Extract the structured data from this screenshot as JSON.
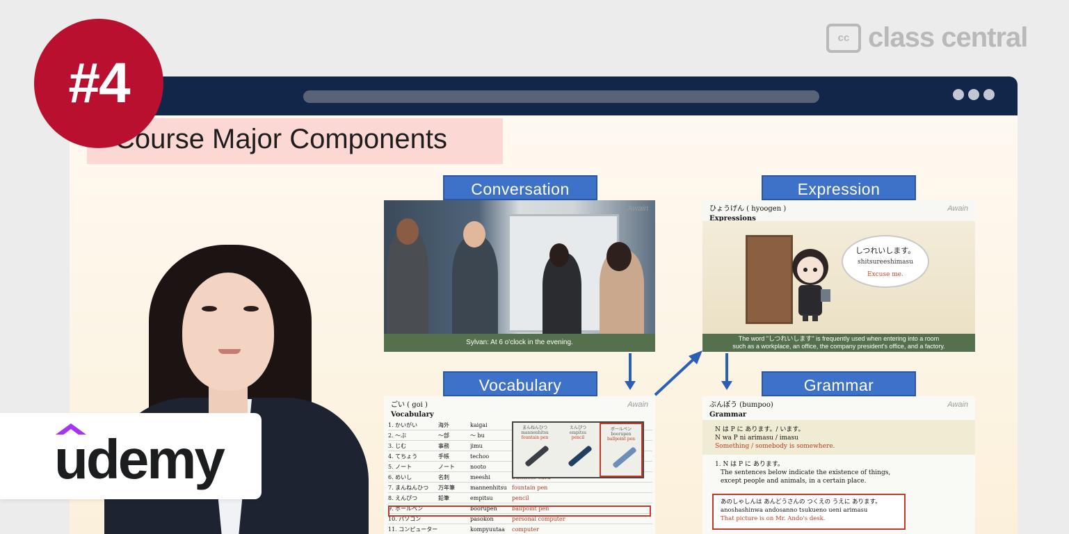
{
  "badge": {
    "rank": "#4",
    "color": "#b8102e"
  },
  "watermark": {
    "icon": "cc",
    "text": "class central"
  },
  "browser": {
    "bar_color": "#12264a",
    "dots_icon": "ellipsis-icon"
  },
  "slide": {
    "title": "Course Major Components",
    "sections": {
      "conversation": "Conversation",
      "expression": "Expression",
      "vocabulary": "Vocabulary",
      "grammar": "Grammar"
    },
    "brand_mark": "Awain",
    "conversation_panel": {
      "subtitle": "Sylvan: At 6 o'clock in the evening."
    },
    "expression_panel": {
      "title_jp": "ひょうげん ( hyoogen )",
      "title_en": "Expressions",
      "bubble_jp": "しつれいします。",
      "bubble_romaji": "shitsureeshimasu",
      "bubble_en": "Excuse me.",
      "caption_line1": "The word \"しつれいします\" is frequently used when entering into a room",
      "caption_line2": "such as a workplace, an office, the company president's office, and a factory."
    },
    "vocabulary_panel": {
      "title_jp": "ごい ( goi )",
      "title_en": "Vocabulary",
      "rows": [
        {
          "kana": "1. かいがい",
          "kanji": "海外",
          "romaji": "kaigai",
          "en": ""
        },
        {
          "kana": "2. ～ぶ",
          "kanji": "～部",
          "romaji": "～ bu",
          "en": ""
        },
        {
          "kana": "3. じむ",
          "kanji": "事務",
          "romaji": "jimu",
          "en": ""
        },
        {
          "kana": "4. てちょう",
          "kanji": "手帳",
          "romaji": "techoo",
          "en": ""
        },
        {
          "kana": "5. ノート",
          "kanji": "ノート",
          "romaji": "nooto",
          "en": ""
        },
        {
          "kana": "6. めいし",
          "kanji": "名刺",
          "romaji": "meeshi",
          "en": "business card"
        },
        {
          "kana": "7. まんねんひつ",
          "kanji": "万年筆",
          "romaji": "mannenhitsu",
          "en": "fountain pen"
        },
        {
          "kana": "8. えんぴつ",
          "kanji": "鉛筆",
          "romaji": "empitsu",
          "en": "pencil"
        },
        {
          "kana": "9. ボールペン",
          "kanji": "",
          "romaji": "boorupen",
          "en": "ballpoint pen"
        },
        {
          "kana": "10. パソコン",
          "kanji": "",
          "romaji": "pasokon",
          "en": "personal computer"
        },
        {
          "kana": "11. コンピューター",
          "kanji": "",
          "romaji": "kompyuutaa",
          "en": "computer"
        }
      ],
      "pens": [
        {
          "jp": "まんねんひつ",
          "ro": "mannenhitsu",
          "en": "fountain pen"
        },
        {
          "jp": "えんぴつ",
          "ro": "empitsu",
          "en": "pencil"
        },
        {
          "jp": "ボールペン",
          "ro": "boorupen",
          "en": "ballpoint pen"
        }
      ]
    },
    "grammar_panel": {
      "title_jp": "ぶんぽう (bumpoo)",
      "title_en": "Grammar",
      "pattern_jp": "N は P に あります。/ います。",
      "pattern_ro": "N wa P ni arimasu / imasu",
      "pattern_en": "Something / somebody is somewhere.",
      "point_head": "1. N は P に あります。",
      "point_desc1": "The sentences below indicate the existence of things,",
      "point_desc2": "except people and animals, in a certain place.",
      "ex_jp": "あのしゃしんは あんどうさんの つくえの うえに あります。",
      "ex_ro": "anoshashinwa andosanno tsukueno ueni arimasu",
      "ex_en": "That picture is on Mr. Ando's desk."
    }
  },
  "udemy": {
    "logo_text": "udemy",
    "hat_color": "#a435f0"
  }
}
